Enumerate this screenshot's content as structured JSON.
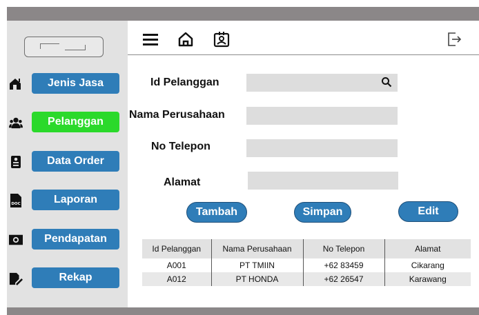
{
  "sidebar": {
    "items": [
      {
        "label": "Jenis Jasa",
        "icon": "home-plus-icon",
        "active": false
      },
      {
        "label": "Pelanggan",
        "icon": "users-icon",
        "active": true
      },
      {
        "label": "Data Order",
        "icon": "clipboard-icon",
        "active": false
      },
      {
        "label": "Laporan",
        "icon": "doc-file-icon",
        "active": false
      },
      {
        "label": "Pendapatan",
        "icon": "money-icon",
        "active": false
      },
      {
        "label": "Rekap",
        "icon": "edit-doc-icon",
        "active": false
      }
    ]
  },
  "header": {
    "icons": [
      "menu-icon",
      "home-icon",
      "id-card-icon",
      "logout-icon"
    ]
  },
  "form": {
    "id_label": "Id Pelanggan",
    "id_value": "",
    "nama_label": "Nama Perusahaan",
    "nama_value": "",
    "telepon_label": "No Telepon",
    "telepon_value": "",
    "alamat_label": "Alamat",
    "alamat_value": ""
  },
  "actions": {
    "tambah": "Tambah",
    "simpan": "Simpan",
    "edit": "Edit"
  },
  "table": {
    "headers": [
      "Id Pelanggan",
      "Nama Perusahaan",
      "No Telepon",
      "Alamat"
    ],
    "rows": [
      [
        "A001",
        "PT TMIIN",
        "+62 83459",
        "Cikarang"
      ],
      [
        "A012",
        "PT HONDA",
        "+62 26547",
        "Karawang"
      ]
    ]
  },
  "colors": {
    "primary": "#2f7db8",
    "active": "#2bd92b",
    "sidebar_bg": "#e2e2e2",
    "frame": "#8b8788"
  }
}
